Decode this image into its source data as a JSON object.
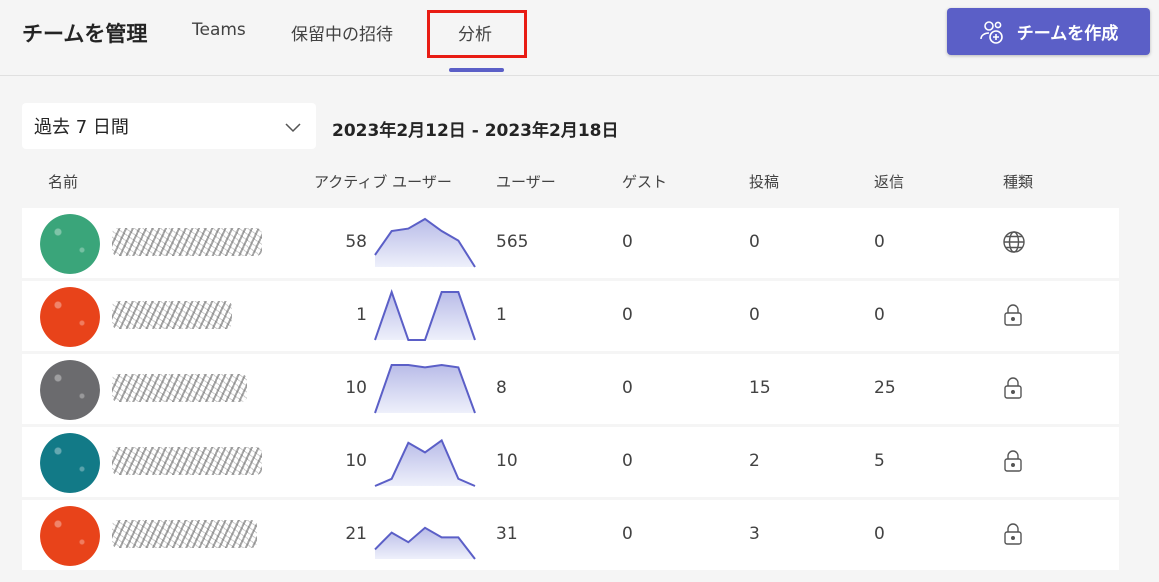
{
  "header": {
    "title": "チームを管理",
    "tabs": [
      "Teams",
      "保留中の招待",
      "分析"
    ],
    "create_button": "チームを作成"
  },
  "filter": {
    "period": "過去 7 日間",
    "date_range": "2023年2月12日 - 2023年2月18日"
  },
  "columns": [
    "名前",
    "アクティブ ユーザー",
    "ユーザー",
    "ゲスト",
    "投稿",
    "返信",
    "種類"
  ],
  "rows": [
    {
      "active_users": "58",
      "users": "565",
      "guests": "0",
      "posts": "0",
      "replies": "0",
      "type_icon": "globe-icon",
      "avatar_color": "#3aa57a",
      "spark": [
        0.25,
        0.75,
        0.8,
        1.0,
        0.75,
        0.55,
        0.0
      ]
    },
    {
      "active_users": "1",
      "users": "1",
      "guests": "0",
      "posts": "0",
      "replies": "0",
      "type_icon": "lock-icon",
      "avatar_color": "#e8431a",
      "spark": [
        0,
        1,
        0,
        0,
        1,
        1,
        0
      ]
    },
    {
      "active_users": "10",
      "users": "8",
      "guests": "0",
      "posts": "15",
      "replies": "25",
      "type_icon": "lock-icon",
      "avatar_color": "#6b6b6e",
      "spark": [
        0.0,
        1.0,
        1.0,
        0.95,
        1.0,
        0.95,
        0.0
      ]
    },
    {
      "active_users": "10",
      "users": "10",
      "guests": "0",
      "posts": "2",
      "replies": "5",
      "type_icon": "lock-icon",
      "avatar_color": "#127a87",
      "spark": [
        0.0,
        0.15,
        0.9,
        0.7,
        0.95,
        0.15,
        0.0
      ]
    },
    {
      "active_users": "21",
      "users": "31",
      "guests": "0",
      "posts": "3",
      "replies": "0",
      "type_icon": "lock-icon",
      "avatar_color": "#e8431a",
      "spark": [
        0.2,
        0.55,
        0.35,
        0.65,
        0.45,
        0.45,
        0.0
      ]
    }
  ]
}
